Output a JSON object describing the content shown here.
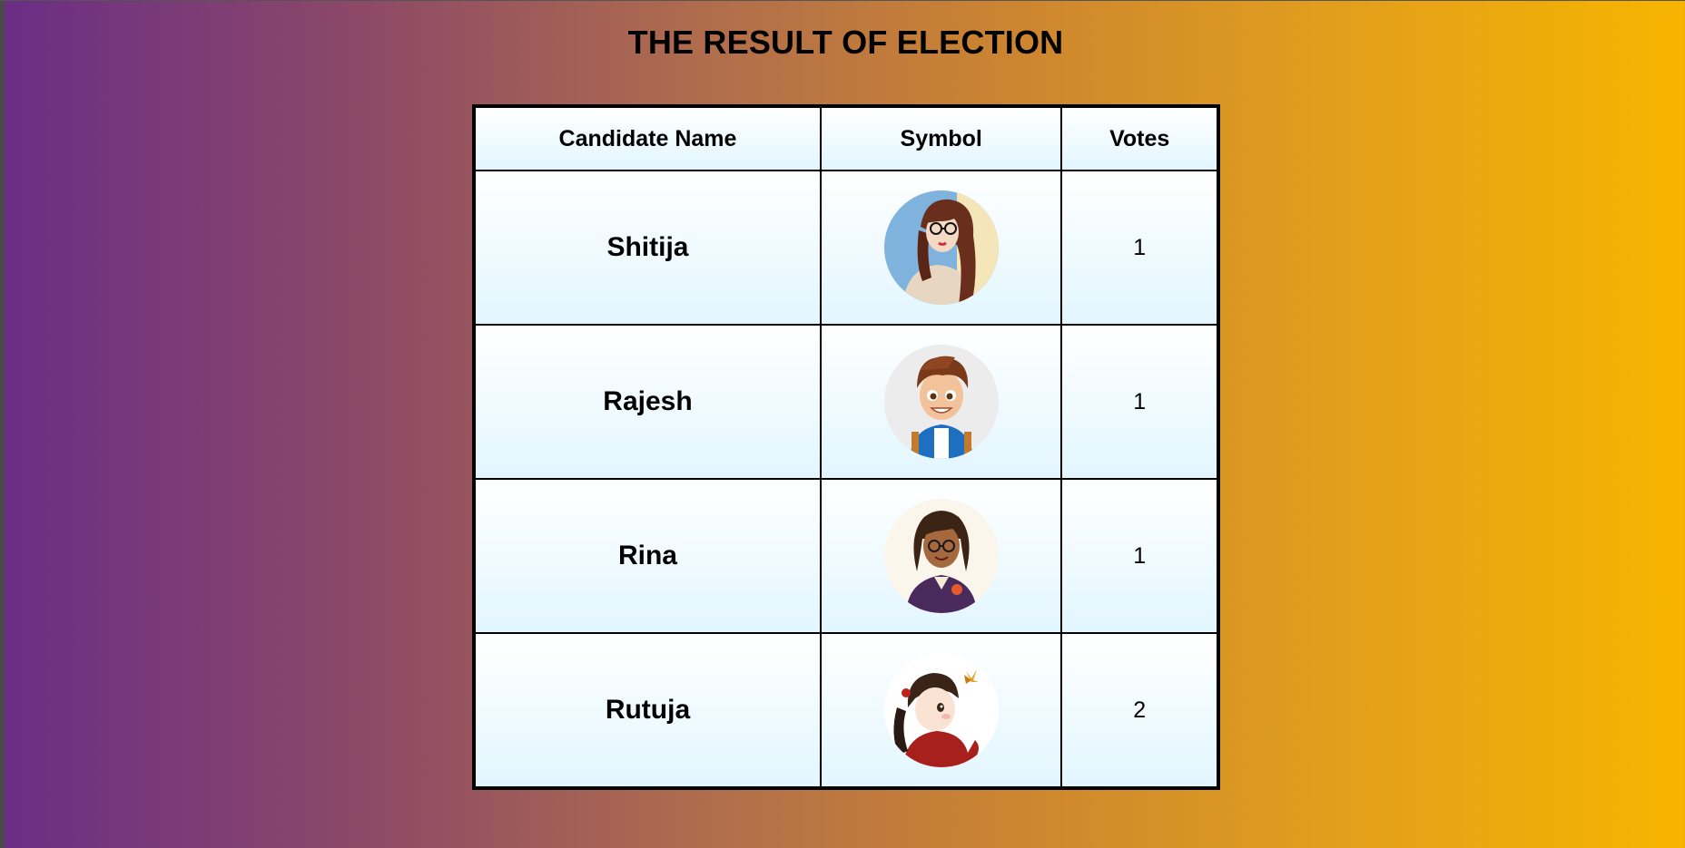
{
  "page": {
    "title": "THE RESULT OF ELECTION"
  },
  "table": {
    "headers": {
      "name": "Candidate Name",
      "symbol": "Symbol",
      "votes": "Votes"
    },
    "rows": [
      {
        "name": "Shitija",
        "symbol_icon": "woman-with-glasses-avatar",
        "votes": "1"
      },
      {
        "name": "Rajesh",
        "symbol_icon": "boy-with-backpack-avatar",
        "votes": "1"
      },
      {
        "name": "Rina",
        "symbol_icon": "girl-in-blazer-avatar",
        "votes": "1"
      },
      {
        "name": "Rutuja",
        "symbol_icon": "girl-with-butterfly-avatar",
        "votes": "2"
      }
    ]
  },
  "colors": {
    "gradient_start": "#6a2d86",
    "gradient_end": "#f7b500",
    "cell_bg_bottom": "#e2f6ff"
  }
}
